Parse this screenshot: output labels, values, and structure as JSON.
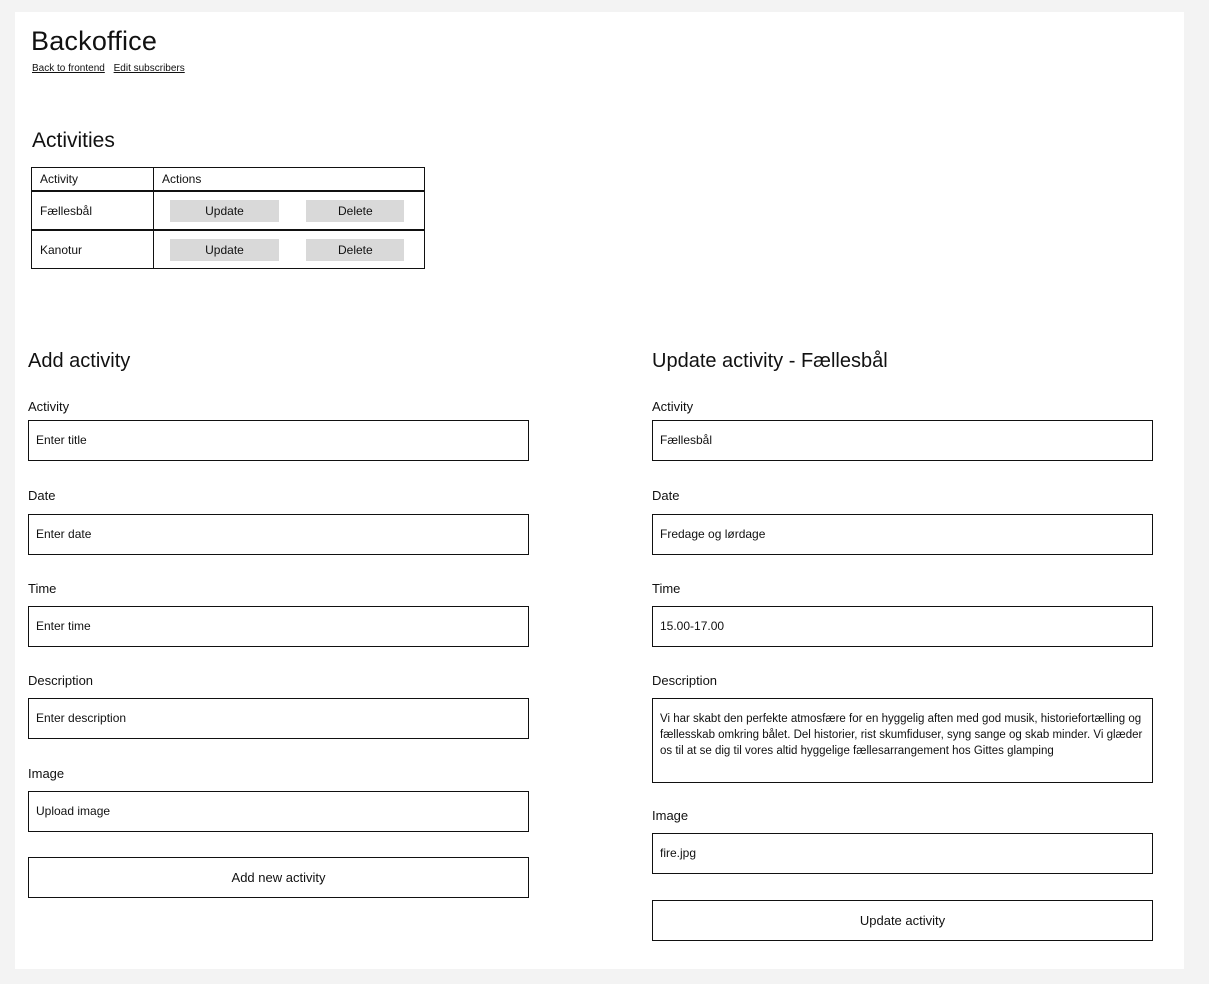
{
  "header": {
    "title": "Backoffice",
    "links": [
      "Back to frontend",
      "Edit subscribers"
    ]
  },
  "activities": {
    "title": "Activities",
    "columns": [
      "Activity",
      "Actions"
    ],
    "rows": [
      {
        "name": "Fællesbål",
        "update_label": "Update",
        "delete_label": "Delete"
      },
      {
        "name": "Kanotur",
        "update_label": "Update",
        "delete_label": "Delete"
      }
    ]
  },
  "add_form": {
    "title": "Add activity",
    "activity_label": "Activity",
    "activity_value": "Enter title",
    "date_label": "Date",
    "date_value": "Enter date",
    "time_label": "Time",
    "time_value": "Enter time",
    "description_label": "Description",
    "description_value": "Enter description",
    "image_label": "Image",
    "image_value": "Upload image",
    "submit_label": "Add new activity"
  },
  "update_form": {
    "title": "Update activity - Fællesbål",
    "activity_label": "Activity",
    "activity_value": "Fællesbål",
    "date_label": "Date",
    "date_value": "Fredage og lørdage",
    "time_label": "Time",
    "time_value": "15.00-17.00",
    "description_label": "Description",
    "description_value": "Vi har skabt den perfekte atmosfære for en hyggelig aften med god musik, historiefortælling og fællesskab omkring bålet. Del historier, rist skumfiduser, syng sange og skab minder. Vi glæder os til at se dig til vores altid hyggelige fællesarrangement hos Gittes glamping",
    "image_label": "Image",
    "image_value": "fire.jpg",
    "submit_label": "Update activity"
  }
}
